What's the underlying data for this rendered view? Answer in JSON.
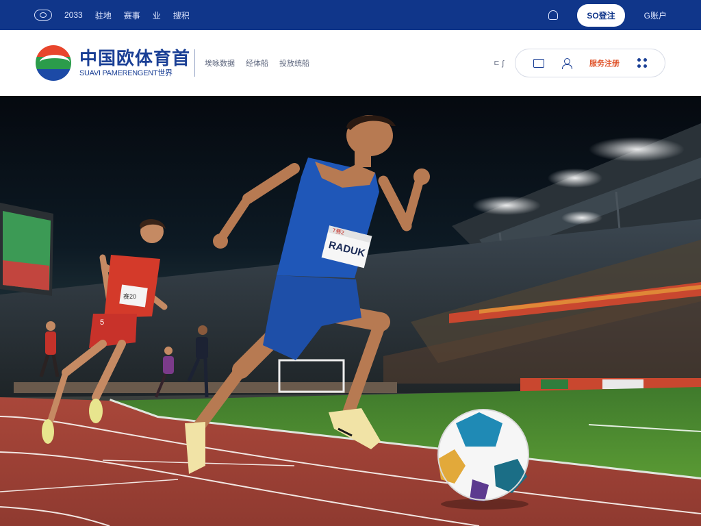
{
  "topbar": {
    "year": "2033",
    "links": [
      "驻地",
      "赛事",
      "业"
    ],
    "search_label": "搜积",
    "login_label": "SO登注",
    "right_link": "G账户"
  },
  "header": {
    "brand_title": "中国欧体育首",
    "brand_subtitle": "SUAVI PAMERENGENT世界",
    "nav": [
      "埃咏数据",
      "经体船",
      "投放统船"
    ],
    "lang_label": "ㄷ ʃ",
    "register_label": "服务注册"
  },
  "hero": {
    "bib_text": "RADUK",
    "bib_top": "T赛2",
    "runner2_bib": "赛20",
    "runner2_number": "5"
  },
  "colors": {
    "topbar_bg": "#10368a",
    "brand_blue": "#1a3f95",
    "register_orange": "#e0552c",
    "track_red": "#b5493a",
    "jersey_blue": "#1f57b8",
    "jersey_red": "#d43a2a"
  }
}
